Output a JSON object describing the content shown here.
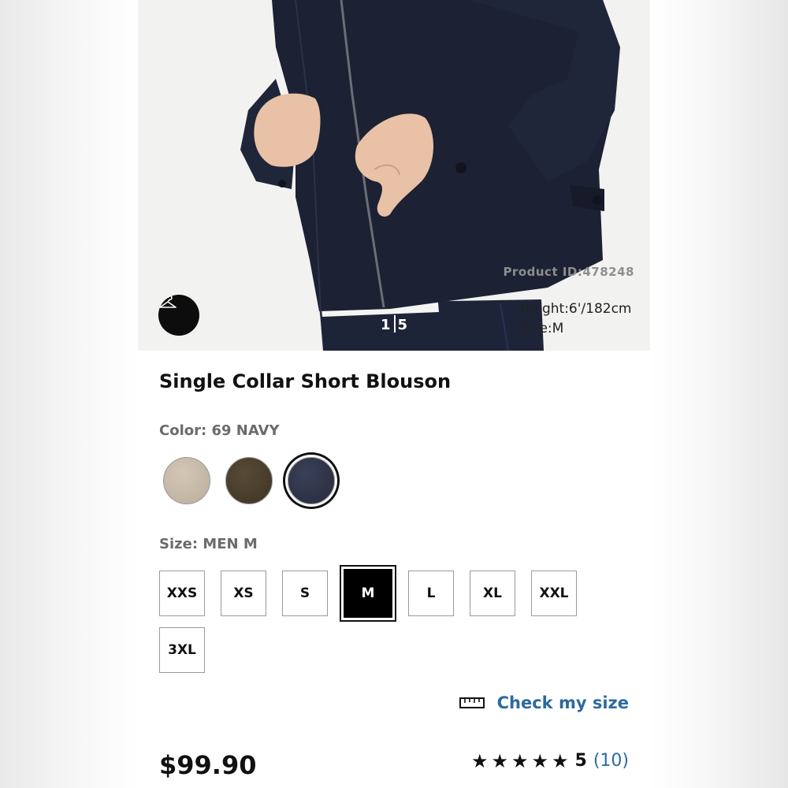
{
  "product": {
    "name": "Single Collar Short Blouson",
    "product_id": "Product ID:478248",
    "image_counter": {
      "current": "1",
      "total": "5"
    },
    "model_height": "Height:6'/182cm",
    "model_size": "Size:M",
    "price": "$99.90"
  },
  "color": {
    "label": "Color: 69 NAVY",
    "options": [
      {
        "name": "beige",
        "hex": "#c5b8a6"
      },
      {
        "name": "brown",
        "hex": "#4a3f2c"
      },
      {
        "name": "navy",
        "hex": "#2e3347",
        "selected": true
      }
    ]
  },
  "size": {
    "label": "Size: MEN M",
    "options": [
      "XXS",
      "XS",
      "S",
      "M",
      "L",
      "XL",
      "XXL",
      "3XL"
    ],
    "selected": "M"
  },
  "check_size": {
    "label": "Check my size",
    "icon": "ruler-icon"
  },
  "rating": {
    "stars": 5,
    "value": "5",
    "count": "(10)"
  },
  "colors": {
    "link": "#2c6aa0",
    "jacket": "#1c2133",
    "jeans": "#1e2438"
  }
}
